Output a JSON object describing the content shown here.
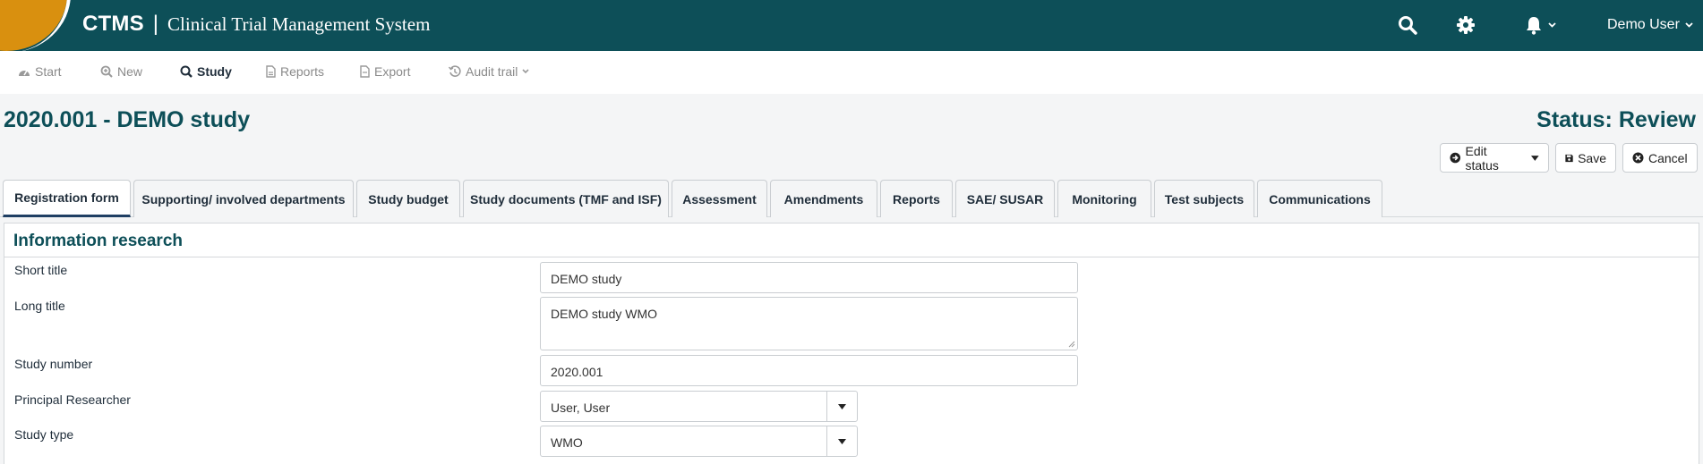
{
  "header": {
    "brand": "CTMS",
    "separator": "|",
    "subtitle": "Clinical Trial Management System",
    "user_name": "Demo User",
    "color_primary": "#0d4f58",
    "color_accent": "#d9900f",
    "icons": [
      "search-icon",
      "gear-icon",
      "bell-icon",
      "chevron-down-icon"
    ]
  },
  "toolbar": {
    "start": "Start",
    "new": "New",
    "study": "Study",
    "reports": "Reports",
    "export": "Export",
    "audit_trail": "Audit trail"
  },
  "page": {
    "title": "2020.001 - DEMO study",
    "status": "Status: Review"
  },
  "actions": {
    "edit_status": "Edit status",
    "save": "Save",
    "cancel": "Cancel"
  },
  "tabs": [
    {
      "label": "Registration form",
      "active": true
    },
    {
      "label": "Supporting/ involved departments"
    },
    {
      "label": "Study budget"
    },
    {
      "label": "Study documents (TMF and ISF)"
    },
    {
      "label": "Assessment"
    },
    {
      "label": "Amendments"
    },
    {
      "label": "Reports"
    },
    {
      "label": "SAE/ SUSAR"
    },
    {
      "label": "Monitoring"
    },
    {
      "label": "Test subjects"
    },
    {
      "label": "Communications"
    }
  ],
  "panel": {
    "title": "Information research",
    "fields": {
      "short_title": {
        "label": "Short title",
        "value": "DEMO study"
      },
      "long_title": {
        "label": "Long title",
        "value": "DEMO study WMO"
      },
      "study_number": {
        "label": "Study number",
        "value": "2020.001"
      },
      "principal_researcher": {
        "label": "Principal Researcher",
        "value": "User, User"
      },
      "study_type": {
        "label": "Study type",
        "value": "WMO"
      }
    }
  }
}
